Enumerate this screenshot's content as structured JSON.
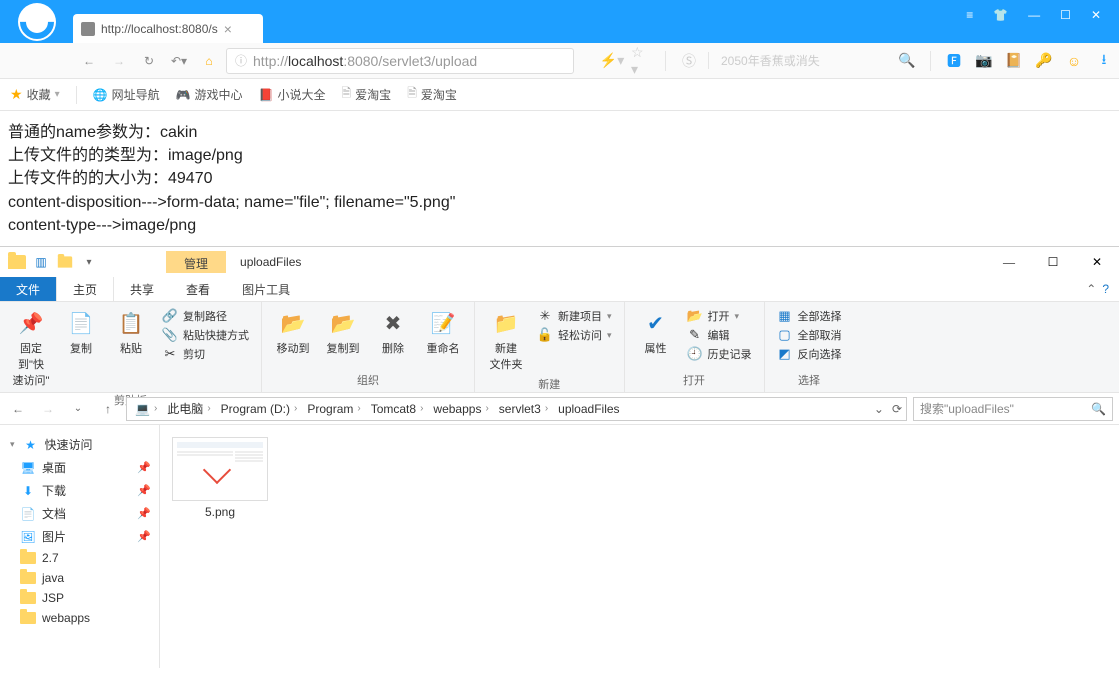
{
  "browser": {
    "tab_title": "http://localhost:8080/s",
    "url_display": {
      "prefix": "http://",
      "host": "localhost",
      "rest": ":8080/servlet3/upload"
    },
    "search_placeholder": "2050年香蕉或消失"
  },
  "bookmarks": {
    "fav": "收藏",
    "items": [
      "网址导航",
      "游戏中心",
      "小说大全",
      "爱淘宝",
      "爱淘宝"
    ]
  },
  "page": {
    "l1": "普通的name参数为：cakin",
    "l2": "上传文件的的类型为：image/png",
    "l3": "上传文件的的大小为：49470",
    "l4": "content-disposition--->form-data; name=\"file\"; filename=\"5.png\"",
    "l5": "content-type--->image/png"
  },
  "explorer": {
    "context_tab": "管理",
    "window_title": "uploadFiles",
    "tabs": {
      "file": "文件",
      "home": "主页",
      "share": "共享",
      "view": "查看",
      "tool": "图片工具"
    },
    "ribbon": {
      "pin": "固定到\"快\n速访问\"",
      "copy": "复制",
      "paste": "粘贴",
      "copy_path": "复制路径",
      "paste_shortcut": "粘贴快捷方式",
      "cut": "剪切",
      "clipboard": "剪贴板",
      "move_to": "移动到",
      "copy_to": "复制到",
      "delete": "删除",
      "rename": "重命名",
      "organize": "组织",
      "new_folder": "新建\n文件夹",
      "new_item": "新建项目",
      "easy_access": "轻松访问",
      "new": "新建",
      "properties": "属性",
      "open": "打开",
      "edit": "编辑",
      "history": "历史记录",
      "open_grp": "打开",
      "select_all": "全部选择",
      "select_none": "全部取消",
      "invert": "反向选择",
      "select": "选择"
    },
    "breadcrumb": [
      "此电脑",
      "Program (D:)",
      "Program",
      "Tomcat8",
      "webapps",
      "servlet3",
      "uploadFiles"
    ],
    "search_placeholder": "搜索\"uploadFiles\"",
    "nav": {
      "quick": "快速访问",
      "desktop": "桌面",
      "downloads": "下载",
      "documents": "文档",
      "pictures": "图片",
      "f27": "2.7",
      "fjava": "java",
      "fjsp": "JSP",
      "fweb": "webapps"
    },
    "file": {
      "name": "5.png"
    }
  }
}
